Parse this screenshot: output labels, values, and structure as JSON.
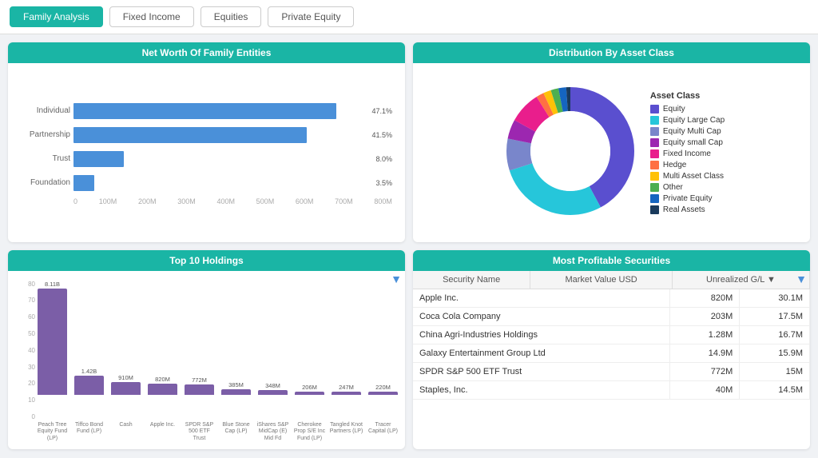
{
  "nav": {
    "tabs": [
      {
        "label": "Family Analysis",
        "active": true
      },
      {
        "label": "Fixed Income",
        "active": false
      },
      {
        "label": "Equities",
        "active": false
      },
      {
        "label": "Private Equity",
        "active": false
      }
    ]
  },
  "netWorth": {
    "title": "Net Worth Of Family Entities",
    "bars": [
      {
        "label": "Individual",
        "pct": "47.1%",
        "value": 47.1
      },
      {
        "label": "Partnership",
        "pct": "41.5%",
        "value": 41.5
      },
      {
        "label": "Trust",
        "pct": "8.0%",
        "value": 8.0
      },
      {
        "label": "Foundation",
        "pct": "3.5%",
        "value": 3.5
      }
    ],
    "xLabels": [
      "0",
      "100M",
      "200M",
      "300M",
      "400M",
      "500M",
      "600M",
      "700M",
      "800M"
    ]
  },
  "distribution": {
    "title": "Distribution By Asset Class",
    "legendTitle": "Asset Class",
    "segments": [
      {
        "label": "Equity",
        "color": "#5a4fcf",
        "percentage": 42
      },
      {
        "label": "Equity Large Cap",
        "color": "#26c6da",
        "percentage": 28
      },
      {
        "label": "Equity Multi Cap",
        "color": "#7986cb",
        "percentage": 8
      },
      {
        "label": "Equity small Cap",
        "color": "#9c27b0",
        "percentage": 5
      },
      {
        "label": "Fixed Income",
        "color": "#e91e8c",
        "percentage": 8
      },
      {
        "label": "Hedge",
        "color": "#ff7043",
        "percentage": 2
      },
      {
        "label": "Multi Asset Class",
        "color": "#ffc107",
        "percentage": 2
      },
      {
        "label": "Other",
        "color": "#4caf50",
        "percentage": 2
      },
      {
        "label": "Private Equity",
        "color": "#1565c0",
        "percentage": 2
      },
      {
        "label": "Real Assets",
        "color": "#1a3a5c",
        "percentage": 1
      }
    ]
  },
  "top10": {
    "title": "Top 10 Holdings",
    "yLabels": [
      "80",
      "70",
      "60",
      "50",
      "40",
      "30",
      "20",
      "10",
      "0"
    ],
    "bars": [
      {
        "label": "Peach Tree Equity Fund (LP)",
        "value": "8.11B",
        "height": 95
      },
      {
        "label": "Tiffco Bond Fund (LP)",
        "value": "1.42B",
        "height": 17
      },
      {
        "label": "Cash",
        "value": "910M",
        "height": 11
      },
      {
        "label": "Apple Inc.",
        "value": "820M",
        "height": 10
      },
      {
        "label": "SPDR S&P 500 ETF Trust",
        "value": "772M",
        "height": 9
      },
      {
        "label": "Blue Stone Cap (LP)",
        "value": "385M",
        "height": 5
      },
      {
        "label": "iShares S&P MidCap (E) Mid Fd",
        "value": "348M",
        "height": 4
      },
      {
        "label": "Cherokee Prop S/E Inc Fund (LP)",
        "value": "206M",
        "height": 3
      },
      {
        "label": "Tangled Knot Partners (LP)",
        "value": "247M",
        "height": 3
      },
      {
        "label": "Tracer Capital (LP)",
        "value": "220M",
        "height": 3
      }
    ]
  },
  "profitable": {
    "title": "Most Profitable Securities",
    "columns": [
      "Security Name",
      "Market Value USD",
      "Unrealized G/L ▼"
    ],
    "rows": [
      {
        "name": "Apple Inc.",
        "marketValue": "820M",
        "unrealized": "30.1M"
      },
      {
        "name": "Coca Cola Company",
        "marketValue": "203M",
        "unrealized": "17.5M"
      },
      {
        "name": "China Agri-Industries Holdings",
        "marketValue": "1.28M",
        "unrealized": "16.7M"
      },
      {
        "name": "Galaxy Entertainment Group Ltd",
        "marketValue": "14.9M",
        "unrealized": "15.9M"
      },
      {
        "name": "SPDR S&P 500 ETF Trust",
        "marketValue": "772M",
        "unrealized": "15M"
      },
      {
        "name": "Staples, Inc.",
        "marketValue": "40M",
        "unrealized": "14.5M"
      }
    ]
  }
}
